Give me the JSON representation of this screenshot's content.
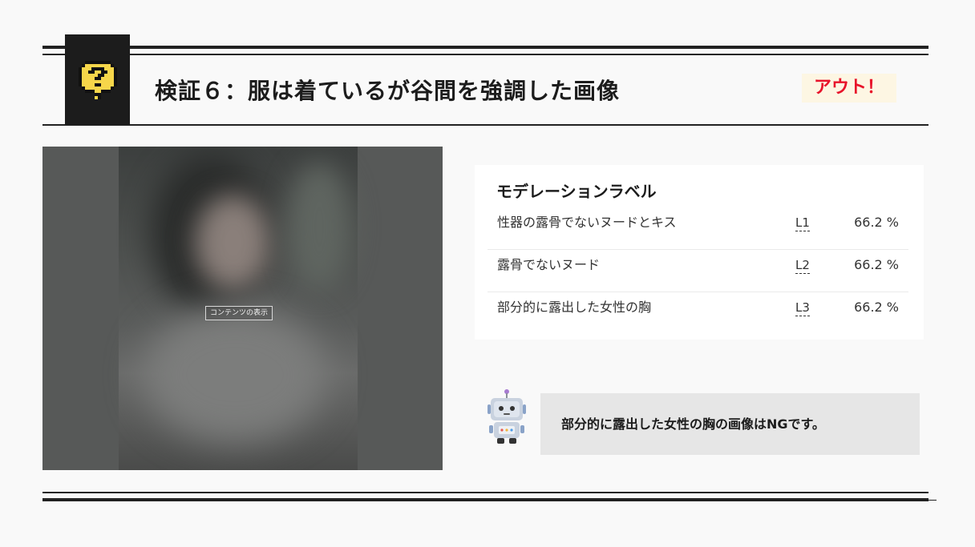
{
  "header": {
    "title": "検証６：服は着ているが谷間を強調した画像",
    "verdict": "アウト！",
    "icon": "question-speech-bubble-icon",
    "accent_color": "#e8132a"
  },
  "image_panel": {
    "show_button_label": "コンテンツの表示"
  },
  "moderation": {
    "title": "モデレーションラベル",
    "labels": [
      {
        "name": "性器の露骨でないヌードとキス",
        "level": "L1",
        "confidence": "66.2 %"
      },
      {
        "name": "露骨でないヌード",
        "level": "L2",
        "confidence": "66.2 %"
      },
      {
        "name": "部分的に露出した女性の胸",
        "level": "L3",
        "confidence": "66.2 %"
      }
    ]
  },
  "note": {
    "icon": "robot-icon",
    "text": "部分的に露出した女性の胸の画像はNGです。"
  }
}
